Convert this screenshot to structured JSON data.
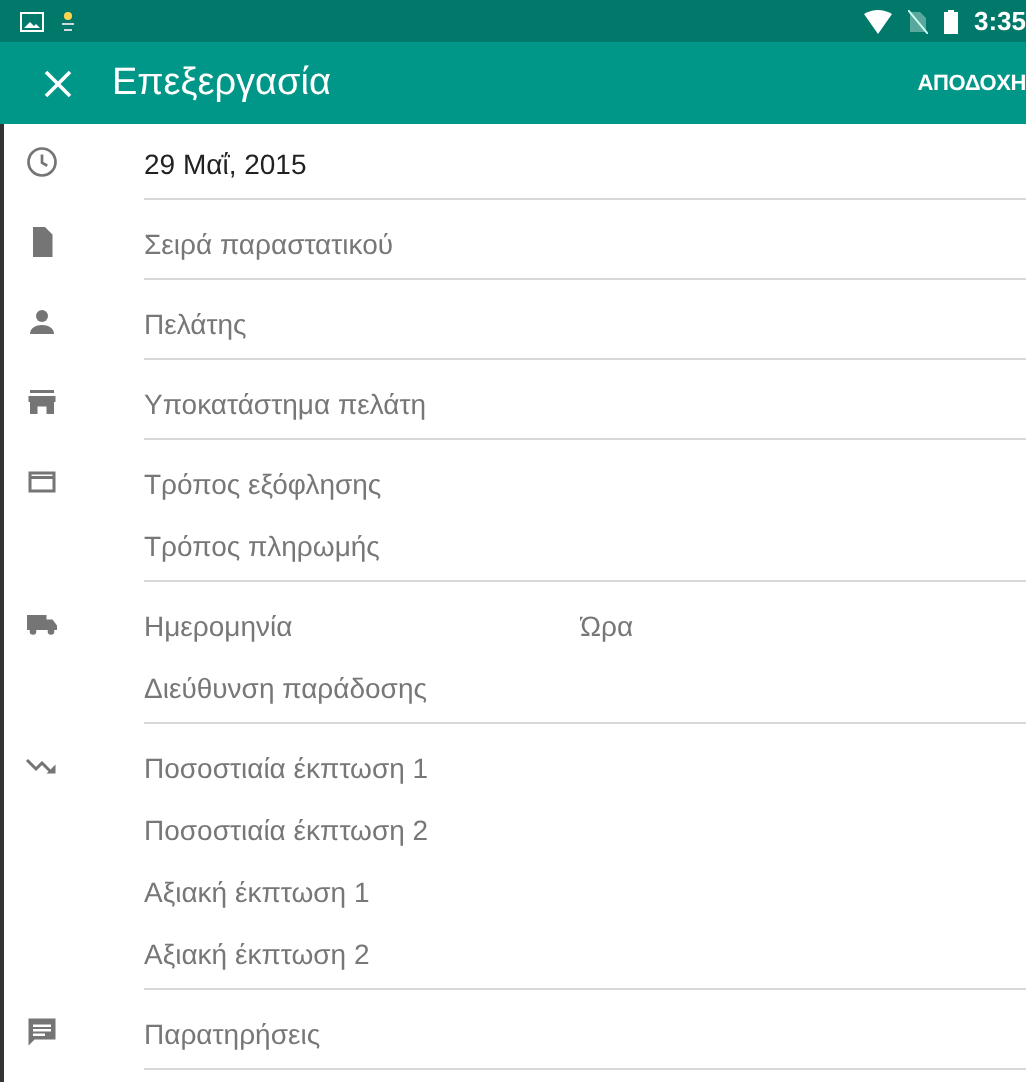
{
  "status_bar": {
    "time": "3:35"
  },
  "toolbar": {
    "title": "Επεξεργασία",
    "action": "ΑΠΟΔΟΧΗ"
  },
  "sections": [
    {
      "kind": "date",
      "rows": [
        [
          {
            "value": "29 Μαΐ, 2015"
          }
        ]
      ]
    },
    {
      "kind": "document",
      "rows": [
        [
          {
            "placeholder": "Σειρά παραστατικού"
          }
        ]
      ]
    },
    {
      "kind": "customer",
      "rows": [
        [
          {
            "placeholder": "Πελάτης"
          }
        ]
      ]
    },
    {
      "kind": "branch",
      "rows": [
        [
          {
            "placeholder": "Υποκατάστημα πελάτη"
          }
        ]
      ]
    },
    {
      "kind": "payment",
      "rows": [
        [
          {
            "placeholder": "Τρόπος εξόφλησης"
          }
        ],
        [
          {
            "placeholder": "Τρόπος πληρωμής"
          }
        ]
      ]
    },
    {
      "kind": "delivery",
      "rows": [
        [
          {
            "placeholder": "Ημερομηνία"
          },
          {
            "placeholder": "Ώρα"
          }
        ],
        [
          {
            "placeholder": "Διεύθυνση παράδοσης"
          }
        ]
      ]
    },
    {
      "kind": "discount",
      "rows": [
        [
          {
            "placeholder": "Ποσοστιαία έκπτωση 1"
          }
        ],
        [
          {
            "placeholder": "Ποσοστιαία έκπτωση 2"
          }
        ],
        [
          {
            "placeholder": "Αξιακή έκπτωση 1"
          }
        ],
        [
          {
            "placeholder": "Αξιακή έκπτωση 2"
          }
        ]
      ]
    },
    {
      "kind": "notes",
      "rows": [
        [
          {
            "placeholder": "Παρατηρήσεις"
          }
        ]
      ]
    }
  ]
}
